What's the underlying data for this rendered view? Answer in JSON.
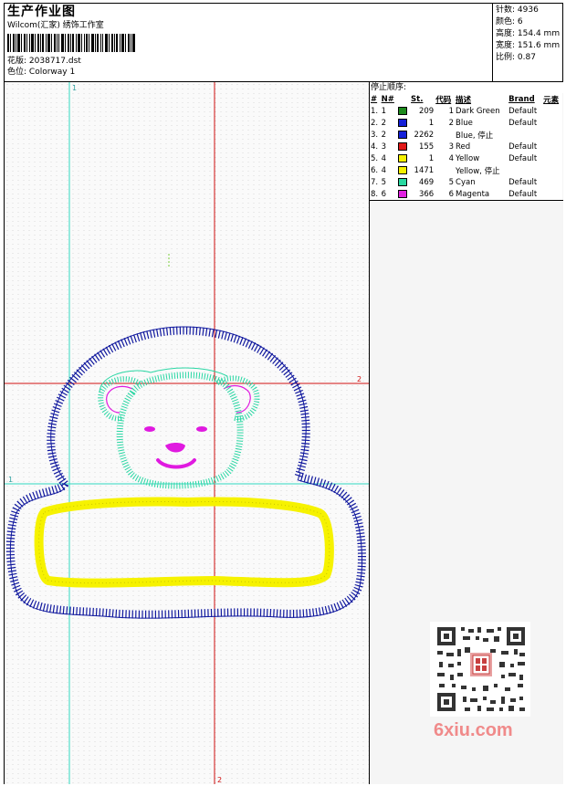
{
  "header": {
    "title": "生产作业图",
    "studio": "Wilcom(汇家) 绣饰工作室",
    "design_label": "花版:",
    "design_value": "2038717.dst",
    "colorway_label": "色位:",
    "colorway_value": "Colorway 1"
  },
  "stats": {
    "stitches_label": "针数:",
    "stitches_value": "4936",
    "colors_label": "颜色:",
    "colors_value": "6",
    "height_label": "高度:",
    "height_value": "154.4 mm",
    "width_label": "宽度:",
    "width_value": "151.6 mm",
    "scale_label": "比例:",
    "scale_value": "0.87"
  },
  "stop_sequence": {
    "heading": "停止顺序:",
    "columns": [
      "#",
      "N#",
      "St.",
      "代码",
      "描述",
      "Brand",
      "元素"
    ],
    "rows": [
      {
        "idx": "1.",
        "n": "1",
        "color": "#1c8a1c",
        "st": "209",
        "code": "1",
        "desc": "Dark Green",
        "brand": "Default"
      },
      {
        "idx": "2.",
        "n": "2",
        "color": "#1420d8",
        "st": "1",
        "code": "2",
        "desc": "Blue",
        "brand": "Default"
      },
      {
        "idx": "3.",
        "n": "2",
        "color": "#1420d8",
        "st": "2262",
        "code": "",
        "desc": "Blue, 停止",
        "brand": ""
      },
      {
        "idx": "4.",
        "n": "3",
        "color": "#e01818",
        "st": "155",
        "code": "3",
        "desc": "Red",
        "brand": "Default"
      },
      {
        "idx": "5.",
        "n": "4",
        "color": "#f4f000",
        "st": "1",
        "code": "4",
        "desc": "Yellow",
        "brand": "Default"
      },
      {
        "idx": "6.",
        "n": "4",
        "color": "#f4f000",
        "st": "1471",
        "code": "",
        "desc": "Yellow, 停止",
        "brand": ""
      },
      {
        "idx": "7.",
        "n": "5",
        "color": "#28d8a0",
        "st": "469",
        "code": "5",
        "desc": "Cyan",
        "brand": "Default"
      },
      {
        "idx": "8.",
        "n": "6",
        "color": "#e020e0",
        "st": "366",
        "code": "6",
        "desc": "Magenta",
        "brand": "Default"
      }
    ]
  },
  "guides": {
    "v1": "1",
    "v2": "2",
    "h1": "1",
    "h2": "2"
  },
  "colors": {
    "blue": "#10189e",
    "yellow": "#f6f200",
    "cyan": "#2ad7a4",
    "magenta": "#e01ae0",
    "guide_red": "#d01010",
    "guide_cyan": "#30d8c0"
  },
  "watermark": "6xiu.com"
}
